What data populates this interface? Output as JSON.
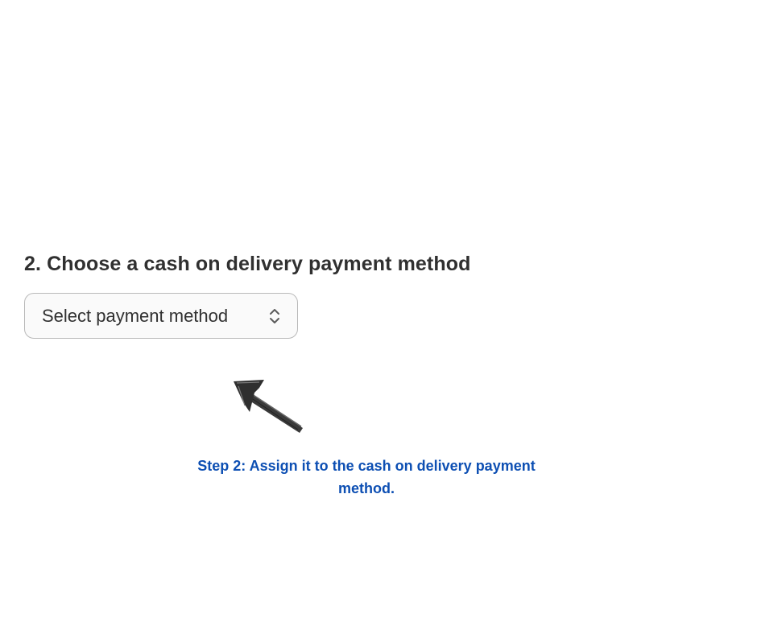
{
  "section": {
    "heading": "2. Choose a cash on delivery payment method"
  },
  "payment_select": {
    "value": "Select payment method",
    "icon": "chevron-up-down-icon"
  },
  "annotation": {
    "arrow_icon": "hand-drawn-arrow-icon",
    "note": "Step 2: Assign it to the cash on delivery payment method.",
    "note_color": "#0d4fb3"
  }
}
